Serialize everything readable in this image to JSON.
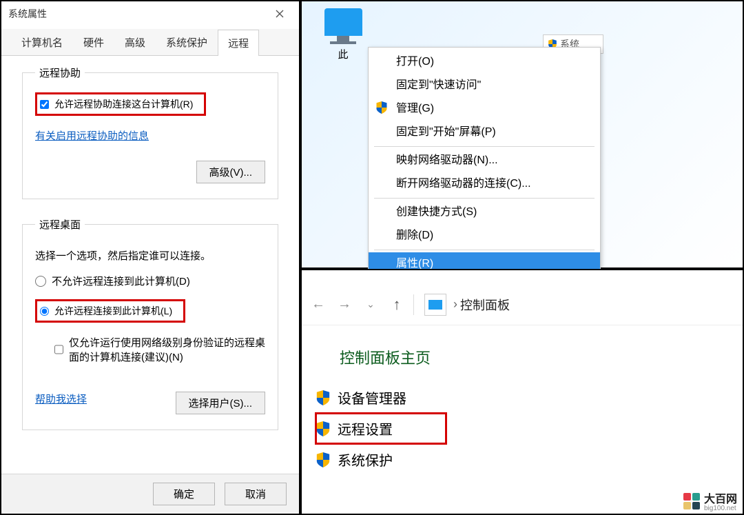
{
  "desktop": {
    "pc_label": "此",
    "partial_window_text": "系统"
  },
  "context_menu": {
    "items": [
      {
        "label": "打开(O)"
      },
      {
        "label": "固定到\"快速访问\""
      },
      {
        "label": "管理(G)",
        "shield": true
      },
      {
        "label": "固定到\"开始\"屏幕(P)"
      },
      {
        "sep": true
      },
      {
        "label": "映射网络驱动器(N)..."
      },
      {
        "label": "断开网络驱动器的连接(C)..."
      },
      {
        "sep": true
      },
      {
        "label": "创建快捷方式(S)"
      },
      {
        "label": "删除(D)"
      },
      {
        "sep": true
      },
      {
        "label": "属性(R)",
        "hover": true
      }
    ]
  },
  "control_panel": {
    "breadcrumb_sep": "›",
    "breadcrumb_text": "控制面板",
    "heading": "控制面板主页",
    "links": [
      {
        "label": "设备管理器",
        "highlight": false
      },
      {
        "label": "远程设置",
        "highlight": true
      },
      {
        "label": "系统保护",
        "highlight": false
      }
    ]
  },
  "dialog": {
    "title": "系统属性",
    "tabs": [
      "计算机名",
      "硬件",
      "高级",
      "系统保护",
      "远程"
    ],
    "active_tab_index": 4,
    "remote_assist": {
      "legend": "远程协助",
      "checkbox_label": "允许远程协助连接这台计算机(R)",
      "checkbox_checked": true,
      "info_link": "有关启用远程协助的信息",
      "advanced_btn": "高级(V)..."
    },
    "remote_desktop": {
      "legend": "远程桌面",
      "note": "选择一个选项，然后指定谁可以连接。",
      "radio_deny": "不允许远程连接到此计算机(D)",
      "radio_allow": "允许远程连接到此计算机(L)",
      "selected": "allow",
      "nla_checkbox": "仅允许运行使用网络级别身份验证的远程桌面的计算机连接(建议)(N)",
      "nla_checked": false,
      "help_link": "帮助我选择",
      "select_users_btn": "选择用户(S)..."
    },
    "footer": {
      "ok": "确定",
      "cancel": "取消"
    }
  },
  "watermark": {
    "name": "大百网",
    "sub": "big100.net"
  }
}
